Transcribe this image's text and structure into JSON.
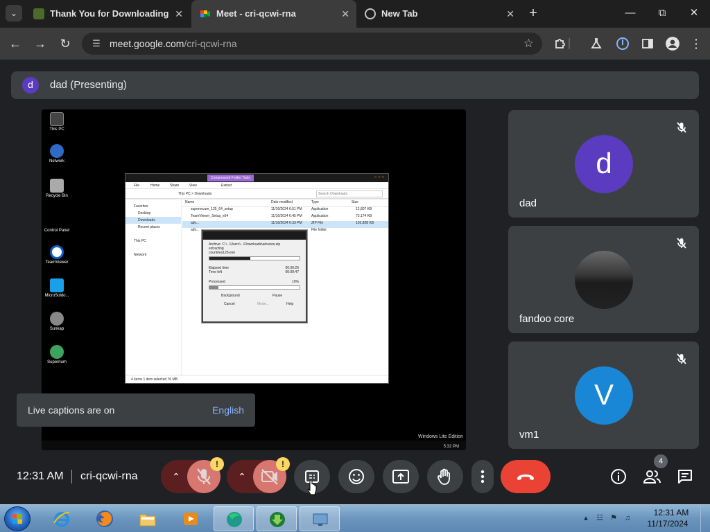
{
  "browser": {
    "tabs": [
      {
        "title": "Thank You for Downloading Ea",
        "active": false
      },
      {
        "title": "Meet - cri-qcwi-rna",
        "active": true
      },
      {
        "title": "New Tab",
        "active": false
      }
    ],
    "url_host": "meet.google.com",
    "url_path": "/cri-qcwi-rna"
  },
  "meet": {
    "presenter_initial": "d",
    "presenting_label": "dad (Presenting)",
    "captions_text": "Live captions are on",
    "captions_language": "English",
    "participants": [
      {
        "name": "dad",
        "initial": "d",
        "color": "#5b3bc0",
        "muted": true
      },
      {
        "name": "fandoo core",
        "initial": "",
        "color": "",
        "muted": true
      },
      {
        "name": "vm1",
        "initial": "V",
        "color": "#1a87d6",
        "muted": true
      }
    ],
    "time": "12:31 AM",
    "meeting_code": "cri-qcwi-rna",
    "people_count": "4",
    "warning_mark": "!"
  },
  "shared_screen": {
    "desktop_icons": [
      "This PC",
      "Network",
      "Recycle Bin",
      "Control Panel",
      "TeamViewer",
      "MicroSoldo...",
      "Sunkap",
      "Superrium"
    ],
    "explorer_title": "Compressed Folder Tools",
    "explorer_menu": [
      "File",
      "Home",
      "Share",
      "View",
      "Extract"
    ],
    "explorer_path": "This PC  >  Downloads",
    "explorer_search": "Search Downloads",
    "explorer_columns": [
      "Name",
      "Date modified",
      "Type",
      "Size"
    ],
    "explorer_files": [
      {
        "name": "superrecum_125_64_setup",
        "date": "11/16/2024 6:51 PM",
        "type": "Application",
        "size": "12,807 KB"
      },
      {
        "name": "TeamViewer_Setup_x64",
        "date": "11/16/2024 6:45 PM",
        "type": "Application",
        "size": "73,174 KB"
      },
      {
        "name": "adv...",
        "date": "11/16/2024 6:33 PM",
        "type": "ZIP File",
        "size": "103,828 KB"
      },
      {
        "name": "adv...",
        "date": "",
        "type": "File folder",
        "size": ""
      }
    ],
    "explorer_nav": [
      "Favorites",
      "Desktop",
      "Downloads",
      "Recent places",
      "This PC",
      "Network"
    ],
    "explorer_status": "4 items    1 item selected  76 MB",
    "zip_archive": "Archive: C:\\...\\Users\\...\\Downloads\\advview.zip",
    "zip_extracting": "extracting",
    "zip_file": "countries126.exe",
    "zip_file_progress": 0.45,
    "zip_elapsed_label": "Elapsed time",
    "zip_elapsed": "00:00:26",
    "zip_left_label": "Time left",
    "zip_left": "00:00:47",
    "zip_processed_label": "Processed",
    "zip_processed": "10%",
    "zip_total_progress": 0.1,
    "zip_buttons": [
      "Background",
      "Pause",
      "Cancel",
      "Mode...",
      "Help"
    ],
    "watermark": "Windows Lite Edition",
    "mini_clock": "5:32 PM"
  },
  "taskbar": {
    "clock_time": "12:31 AM",
    "clock_date": "11/17/2024"
  }
}
